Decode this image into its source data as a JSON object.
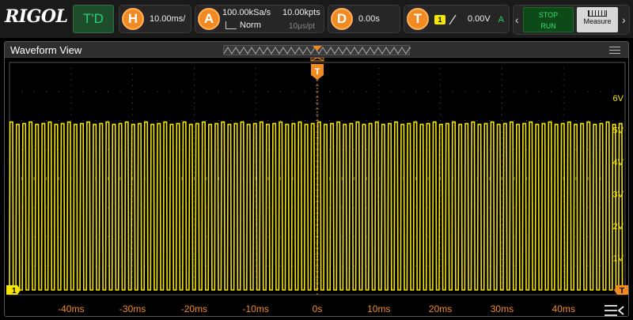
{
  "brand": "RIGOL",
  "mode": "T'D",
  "horizontal": {
    "letter": "H",
    "timebase": "10.00ms/"
  },
  "acquire": {
    "letter": "A",
    "sample_rate": "100.00kSa/s",
    "memory_depth": "10.00kpts",
    "mode": "Norm",
    "resolution": "10μs/pt"
  },
  "delay": {
    "letter": "D",
    "value": "0.00s"
  },
  "trigger": {
    "letter": "T",
    "channel": "1",
    "level": "0.00V",
    "status": "A"
  },
  "controls": {
    "run_state_line1": "STOP",
    "run_state_line2": "RUN",
    "measure_label": "Measure"
  },
  "waveform": {
    "title": "Waveform View",
    "trigger_marker": "T",
    "channel_marker": "1",
    "y_labels": [
      "6V",
      "5V",
      "4V",
      "3V",
      "2V",
      "1V"
    ],
    "x_labels": [
      "-40ms",
      "-30ms",
      "-20ms",
      "-10ms",
      "0s",
      "10ms",
      "20ms",
      "30ms",
      "40ms"
    ]
  },
  "signal": {
    "channel": 1,
    "color": "#f6e600",
    "type": "square",
    "low_V": 0.0,
    "high_V": 5.2,
    "cycles_on_screen": 96
  },
  "colors": {
    "accent_orange": "#f28a22",
    "channel1": "#f6e600",
    "grid": "#444444",
    "axis_label": "#f28a22"
  }
}
